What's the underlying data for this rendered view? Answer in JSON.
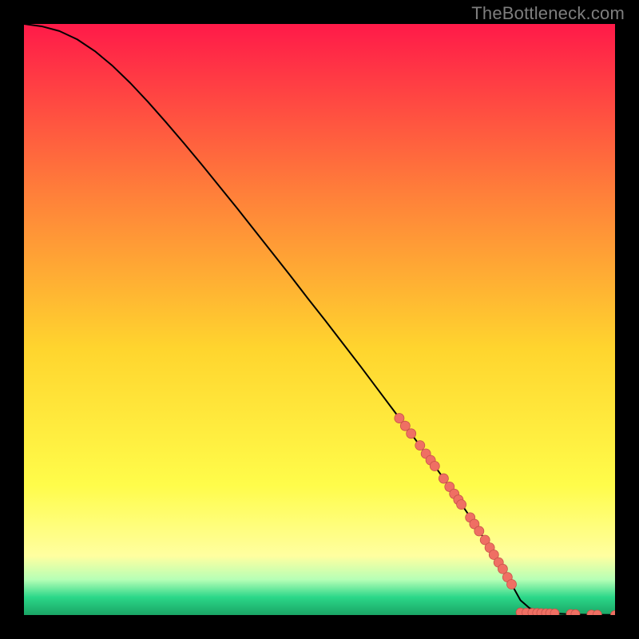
{
  "watermark": "TheBottleneck.com",
  "colors": {
    "page_bg": "#000000",
    "watermark": "#7e7e7e",
    "curve": "#000000",
    "marker_fill": "#ef6f63",
    "marker_stroke": "#c75249",
    "grad_top": "#ff1a49",
    "grad_mid_upper": "#ff7d3a",
    "grad_mid": "#ffd52e",
    "grad_mid_lower": "#fffc4a",
    "grad_yellow_pale": "#ffffa0",
    "grad_green_pale": "#b6ffb6",
    "grad_green": "#2bd789",
    "grad_green_dark": "#1aa565"
  },
  "chart_data": {
    "type": "line",
    "xlabel": "",
    "ylabel": "",
    "xlim": [
      0,
      100
    ],
    "ylim": [
      0,
      100
    ],
    "curve": {
      "x": [
        0,
        3,
        6,
        9,
        12,
        15,
        18,
        21,
        24,
        27,
        30,
        33,
        36,
        39,
        42,
        45,
        48,
        51,
        54,
        57,
        60,
        63,
        66,
        69,
        72,
        75,
        78,
        81,
        82.5,
        84,
        85.5,
        87,
        90,
        93,
        96,
        100
      ],
      "y": [
        100,
        99.6,
        98.8,
        97.4,
        95.4,
        92.9,
        90.0,
        86.8,
        83.4,
        79.9,
        76.3,
        72.6,
        68.9,
        65.1,
        61.3,
        57.5,
        53.6,
        49.8,
        45.9,
        42.0,
        38.0,
        34.0,
        30.0,
        25.9,
        21.7,
        17.3,
        12.7,
        7.8,
        5.2,
        2.5,
        1.2,
        0.6,
        0.25,
        0.1,
        0.05,
        0.02
      ]
    },
    "markers_on_curve": {
      "x": [
        63.5,
        64.5,
        65.5,
        67.0,
        68.0,
        68.8,
        69.5,
        71.0,
        72.0,
        72.8,
        73.5,
        74.0,
        75.5,
        76.2,
        77.0,
        78.0,
        78.8,
        79.5,
        80.3,
        81.0,
        81.8,
        82.5
      ],
      "y": [
        33.3,
        32.0,
        30.7,
        28.7,
        27.3,
        26.2,
        25.2,
        23.1,
        21.7,
        20.5,
        19.5,
        18.7,
        16.5,
        15.4,
        14.2,
        12.7,
        11.4,
        10.2,
        8.9,
        7.8,
        6.4,
        5.2
      ]
    },
    "markers_baseline": {
      "x": [
        84.0,
        85.0,
        86.0,
        86.8,
        87.5,
        88.3,
        89.0,
        89.8,
        92.5,
        93.3,
        96.0,
        97.0,
        100.0
      ],
      "y": [
        0.45,
        0.42,
        0.4,
        0.38,
        0.36,
        0.34,
        0.32,
        0.3,
        0.2,
        0.18,
        0.1,
        0.08,
        0.02
      ]
    }
  }
}
